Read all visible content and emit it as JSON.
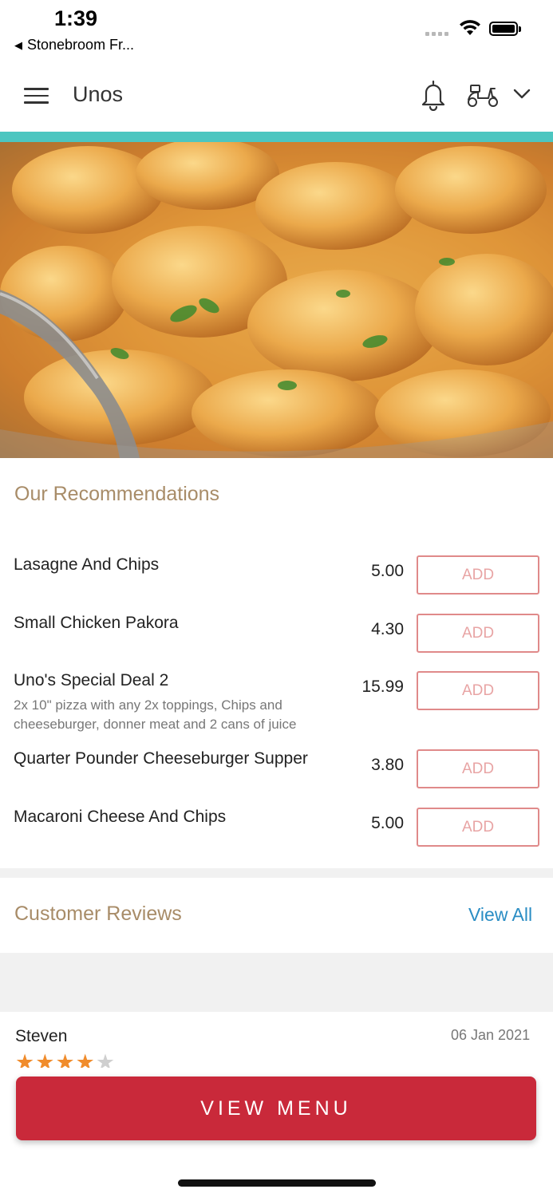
{
  "status_bar": {
    "time": "1:39",
    "back_app": "Stonebroom Fr..."
  },
  "header": {
    "title": "Unos",
    "icons": [
      "menu-icon",
      "bell-icon",
      "scooter-icon",
      "chevron-down-icon"
    ],
    "accent_color": "#4cc6c0"
  },
  "hero": {
    "image": "food-photo"
  },
  "recommendations": {
    "title": "Our Recommendations",
    "add_label": "ADD",
    "items": [
      {
        "name": "Lasagne And Chips",
        "description": "",
        "price": "5.00"
      },
      {
        "name": "Small Chicken Pakora",
        "description": "",
        "price": "4.30"
      },
      {
        "name": "Uno's Special Deal 2",
        "description": "2x 10\" pizza with any 2x toppings, Chips and cheeseburger, donner meat and 2 cans of juice",
        "price": "15.99"
      },
      {
        "name": "Quarter Pounder Cheeseburger Supper",
        "description": "",
        "price": "3.80"
      },
      {
        "name": "Macaroni Cheese And Chips",
        "description": "",
        "price": "5.00"
      }
    ]
  },
  "reviews": {
    "title": "Customer Reviews",
    "view_all": "View All",
    "items": [
      {
        "name": "Steven",
        "date": "06 Jan 2021",
        "rating": 4,
        "max_rating": 5
      }
    ]
  },
  "footer": {
    "view_menu": "VIEW MENU",
    "button_color": "#c9293a"
  }
}
